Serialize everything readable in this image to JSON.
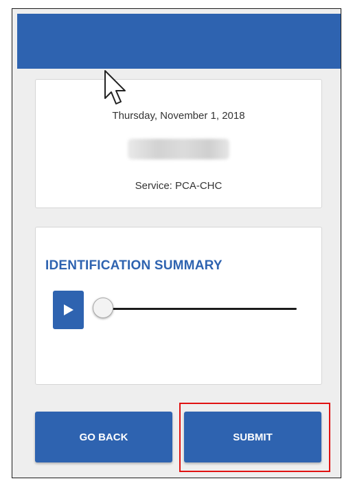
{
  "info": {
    "date": "Thursday, November 1, 2018",
    "service": "Service: PCA-CHC"
  },
  "audio": {
    "title": "IDENTIFICATION SUMMARY",
    "play_icon": "play-icon",
    "progress": 0
  },
  "actions": {
    "back_label": "GO BACK",
    "submit_label": "SUBMIT"
  },
  "colors": {
    "primary": "#2e63b0",
    "background": "#eeeeee",
    "highlight": "#e01010"
  }
}
